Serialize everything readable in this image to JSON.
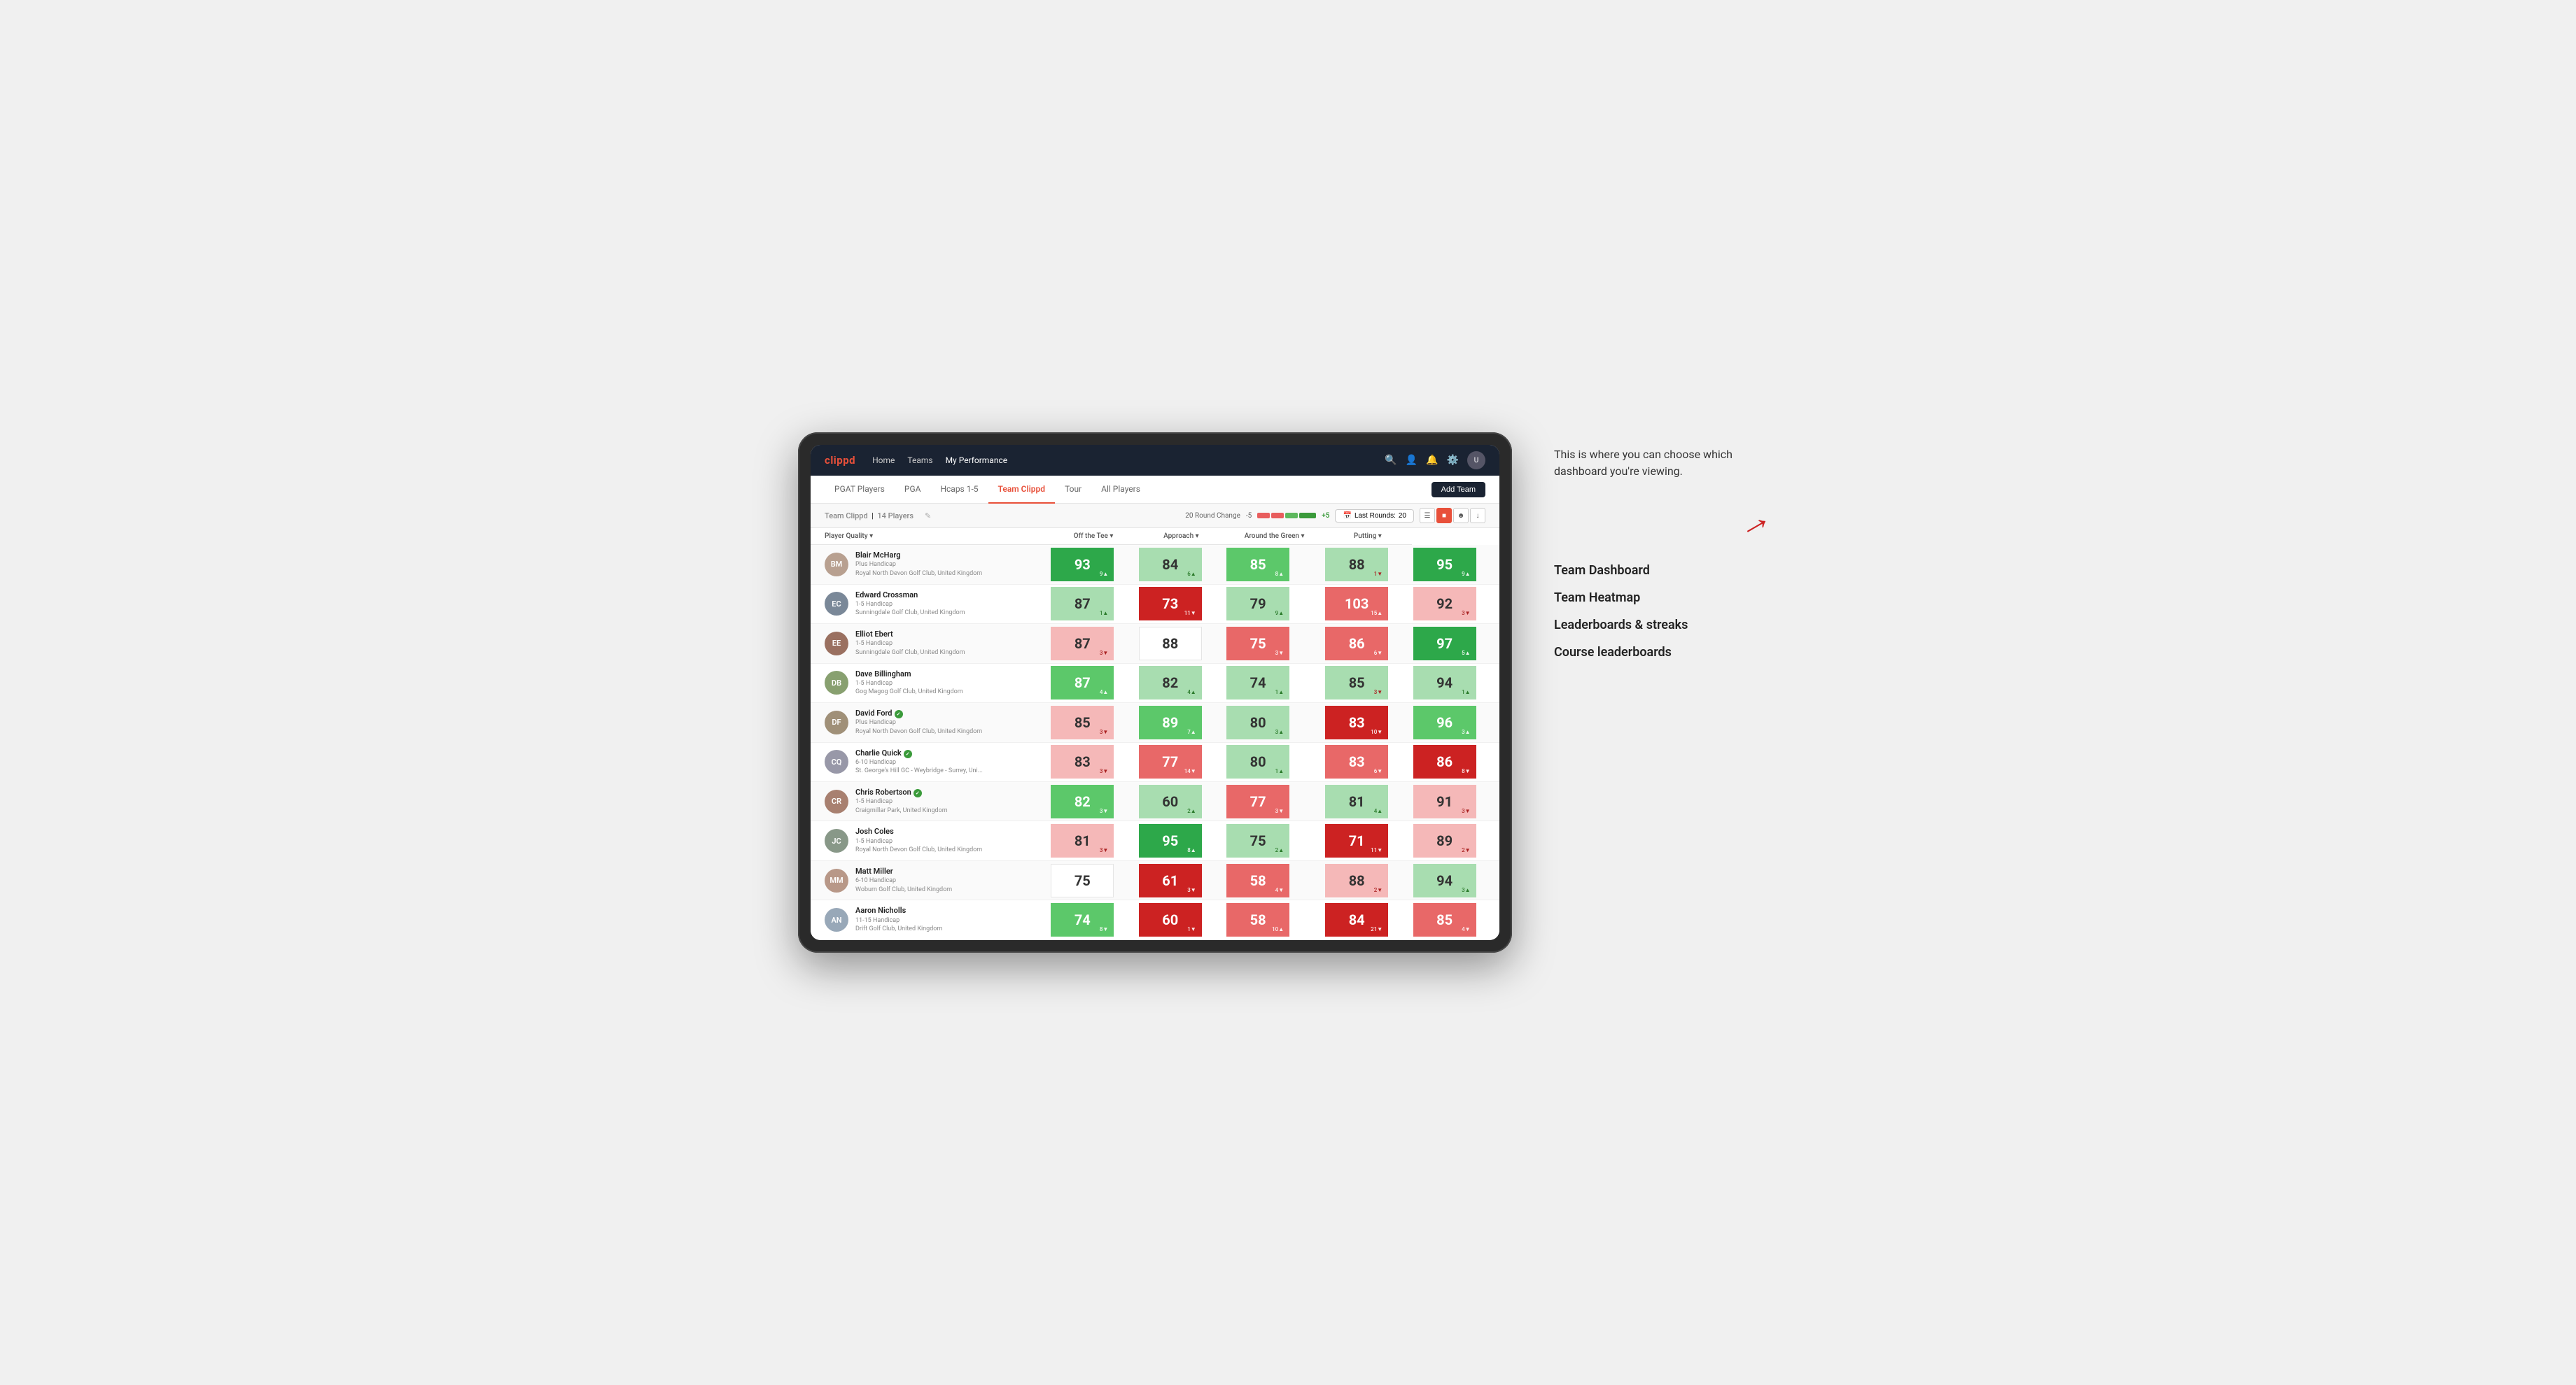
{
  "annotation": {
    "intro_text": "This is where you can choose which dashboard you're viewing.",
    "options": [
      "Team Dashboard",
      "Team Heatmap",
      "Leaderboards & streaks",
      "Course leaderboards"
    ]
  },
  "nav": {
    "logo": "clippd",
    "links": [
      "Home",
      "Teams",
      "My Performance"
    ],
    "active_link": "My Performance",
    "icons": [
      "search",
      "user",
      "bell",
      "settings",
      "avatar"
    ]
  },
  "sub_tabs": {
    "tabs": [
      "PGAT Players",
      "PGA",
      "Hcaps 1-5",
      "Team Clippd",
      "Tour",
      "All Players"
    ],
    "active_tab": "Team Clippd",
    "add_team_label": "Add Team"
  },
  "team_header": {
    "name": "Team Clippd",
    "player_count": "14 Players",
    "round_change_label": "20 Round Change",
    "round_change_minus": "-5",
    "round_change_plus": "+5",
    "last_rounds_label": "Last Rounds:",
    "last_rounds_value": "20"
  },
  "table": {
    "columns": [
      "Player Quality ▾",
      "Off the Tee ▾",
      "Approach ▾",
      "Around the Green ▾",
      "Putting ▾"
    ],
    "rows": [
      {
        "name": "Blair McHarg",
        "handicap": "Plus Handicap",
        "club": "Royal North Devon Golf Club, United Kingdom",
        "avatar_color": "#b8a090",
        "initials": "BM",
        "scores": [
          {
            "value": 93,
            "delta": "+9",
            "dir": "up",
            "color": "green-strong"
          },
          {
            "value": 84,
            "delta": "+6",
            "dir": "up",
            "color": "green-light"
          },
          {
            "value": 85,
            "delta": "+8",
            "dir": "up",
            "color": "green-medium"
          },
          {
            "value": 88,
            "delta": "-1",
            "dir": "down",
            "color": "green-light"
          },
          {
            "value": 95,
            "delta": "+9",
            "dir": "up",
            "color": "green-strong"
          }
        ]
      },
      {
        "name": "Edward Crossman",
        "handicap": "1-5 Handicap",
        "club": "Sunningdale Golf Club, United Kingdom",
        "avatar_color": "#7a8898",
        "initials": "EC",
        "scores": [
          {
            "value": 87,
            "delta": "+1",
            "dir": "up",
            "color": "green-light"
          },
          {
            "value": 73,
            "delta": "-11",
            "dir": "down",
            "color": "red-strong"
          },
          {
            "value": 79,
            "delta": "+9",
            "dir": "up",
            "color": "green-light"
          },
          {
            "value": 103,
            "delta": "+15",
            "dir": "up",
            "color": "red-medium"
          },
          {
            "value": 92,
            "delta": "-3",
            "dir": "down",
            "color": "red-light"
          }
        ]
      },
      {
        "name": "Elliot Ebert",
        "handicap": "1-5 Handicap",
        "club": "Sunningdale Golf Club, United Kingdom",
        "avatar_color": "#9a7060",
        "initials": "EE",
        "scores": [
          {
            "value": 87,
            "delta": "-3",
            "dir": "down",
            "color": "red-light"
          },
          {
            "value": 88,
            "delta": "",
            "dir": "",
            "color": "neutral"
          },
          {
            "value": 75,
            "delta": "-3",
            "dir": "down",
            "color": "red-medium"
          },
          {
            "value": 86,
            "delta": "-6",
            "dir": "down",
            "color": "red-medium"
          },
          {
            "value": 97,
            "delta": "+5",
            "dir": "up",
            "color": "green-strong"
          }
        ]
      },
      {
        "name": "Dave Billingham",
        "handicap": "1-5 Handicap",
        "club": "Gog Magog Golf Club, United Kingdom",
        "avatar_color": "#88a070",
        "initials": "DB",
        "scores": [
          {
            "value": 87,
            "delta": "+4",
            "dir": "up",
            "color": "green-medium"
          },
          {
            "value": 82,
            "delta": "+4",
            "dir": "up",
            "color": "green-light"
          },
          {
            "value": 74,
            "delta": "+1",
            "dir": "up",
            "color": "green-light"
          },
          {
            "value": 85,
            "delta": "-3",
            "dir": "down",
            "color": "green-light"
          },
          {
            "value": 94,
            "delta": "+1",
            "dir": "up",
            "color": "green-light"
          }
        ]
      },
      {
        "name": "David Ford",
        "handicap": "Plus Handicap",
        "club": "Royal North Devon Golf Club, United Kingdom",
        "avatar_color": "#a09078",
        "initials": "DF",
        "badge": true,
        "scores": [
          {
            "value": 85,
            "delta": "-3",
            "dir": "down",
            "color": "red-light"
          },
          {
            "value": 89,
            "delta": "+7",
            "dir": "up",
            "color": "green-medium"
          },
          {
            "value": 80,
            "delta": "+3",
            "dir": "up",
            "color": "green-light"
          },
          {
            "value": 83,
            "delta": "-10",
            "dir": "down",
            "color": "red-strong"
          },
          {
            "value": 96,
            "delta": "+3",
            "dir": "up",
            "color": "green-medium"
          }
        ]
      },
      {
        "name": "Charlie Quick",
        "handicap": "6-10 Handicap",
        "club": "St. George's Hill GC - Weybridge - Surrey, Uni...",
        "avatar_color": "#9898a8",
        "initials": "CQ",
        "badge": true,
        "scores": [
          {
            "value": 83,
            "delta": "-3",
            "dir": "down",
            "color": "red-light"
          },
          {
            "value": 77,
            "delta": "-14",
            "dir": "down",
            "color": "red-medium"
          },
          {
            "value": 80,
            "delta": "+1",
            "dir": "up",
            "color": "green-light"
          },
          {
            "value": 83,
            "delta": "-6",
            "dir": "down",
            "color": "red-medium"
          },
          {
            "value": 86,
            "delta": "-8",
            "dir": "down",
            "color": "red-strong"
          }
        ]
      },
      {
        "name": "Chris Robertson",
        "handicap": "1-5 Handicap",
        "club": "Craigmillar Park, United Kingdom",
        "avatar_color": "#a88070",
        "initials": "CR",
        "badge": true,
        "scores": [
          {
            "value": 82,
            "delta": "-3",
            "dir": "down",
            "color": "green-medium"
          },
          {
            "value": 60,
            "delta": "+2",
            "dir": "up",
            "color": "green-light"
          },
          {
            "value": 77,
            "delta": "-3",
            "dir": "down",
            "color": "red-medium"
          },
          {
            "value": 81,
            "delta": "+4",
            "dir": "up",
            "color": "green-light"
          },
          {
            "value": 91,
            "delta": "-3",
            "dir": "down",
            "color": "red-light"
          }
        ]
      },
      {
        "name": "Josh Coles",
        "handicap": "1-5 Handicap",
        "club": "Royal North Devon Golf Club, United Kingdom",
        "avatar_color": "#889888",
        "initials": "JC",
        "scores": [
          {
            "value": 81,
            "delta": "-3",
            "dir": "down",
            "color": "red-light"
          },
          {
            "value": 95,
            "delta": "+8",
            "dir": "up",
            "color": "green-strong"
          },
          {
            "value": 75,
            "delta": "+2",
            "dir": "up",
            "color": "green-light"
          },
          {
            "value": 71,
            "delta": "-11",
            "dir": "down",
            "color": "red-strong"
          },
          {
            "value": 89,
            "delta": "-2",
            "dir": "down",
            "color": "red-light"
          }
        ]
      },
      {
        "name": "Matt Miller",
        "handicap": "6-10 Handicap",
        "club": "Woburn Golf Club, United Kingdom",
        "avatar_color": "#b89888",
        "initials": "MM",
        "scores": [
          {
            "value": 75,
            "delta": "",
            "dir": "",
            "color": "neutral"
          },
          {
            "value": 61,
            "delta": "-3",
            "dir": "down",
            "color": "red-strong"
          },
          {
            "value": 58,
            "delta": "-4",
            "dir": "down",
            "color": "red-medium"
          },
          {
            "value": 88,
            "delta": "-2",
            "dir": "down",
            "color": "red-light"
          },
          {
            "value": 94,
            "delta": "+3",
            "dir": "up",
            "color": "green-light"
          }
        ]
      },
      {
        "name": "Aaron Nicholls",
        "handicap": "11-15 Handicap",
        "club": "Drift Golf Club, United Kingdom",
        "avatar_color": "#98a8b8",
        "initials": "AN",
        "scores": [
          {
            "value": 74,
            "delta": "-8",
            "dir": "down",
            "color": "green-medium"
          },
          {
            "value": 60,
            "delta": "-1",
            "dir": "down",
            "color": "red-strong"
          },
          {
            "value": 58,
            "delta": "+10",
            "dir": "up",
            "color": "red-medium"
          },
          {
            "value": 84,
            "delta": "-21",
            "dir": "down",
            "color": "red-strong"
          },
          {
            "value": 85,
            "delta": "-4",
            "dir": "down",
            "color": "red-medium"
          }
        ]
      }
    ]
  }
}
